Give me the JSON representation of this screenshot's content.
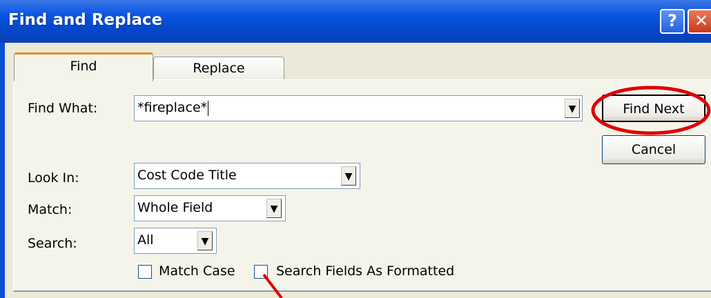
{
  "window": {
    "title": "Find and Replace",
    "help_glyph": "?",
    "close_glyph": "✕"
  },
  "tabs": [
    {
      "label": "Find"
    },
    {
      "label": "Replace"
    }
  ],
  "form": {
    "find_what_label": "Find What:",
    "find_what_value": "*fireplace*",
    "look_in_label": "Look In:",
    "look_in_value": "Cost Code Title",
    "match_label": "Match:",
    "match_value": "Whole Field",
    "search_label": "Search:",
    "search_value": "All",
    "match_case_label": "Match Case",
    "search_formatted_label": "Search Fields As Formatted"
  },
  "buttons": {
    "find_next": "Find Next",
    "cancel": "Cancel"
  },
  "annotation_color": "#e00000"
}
